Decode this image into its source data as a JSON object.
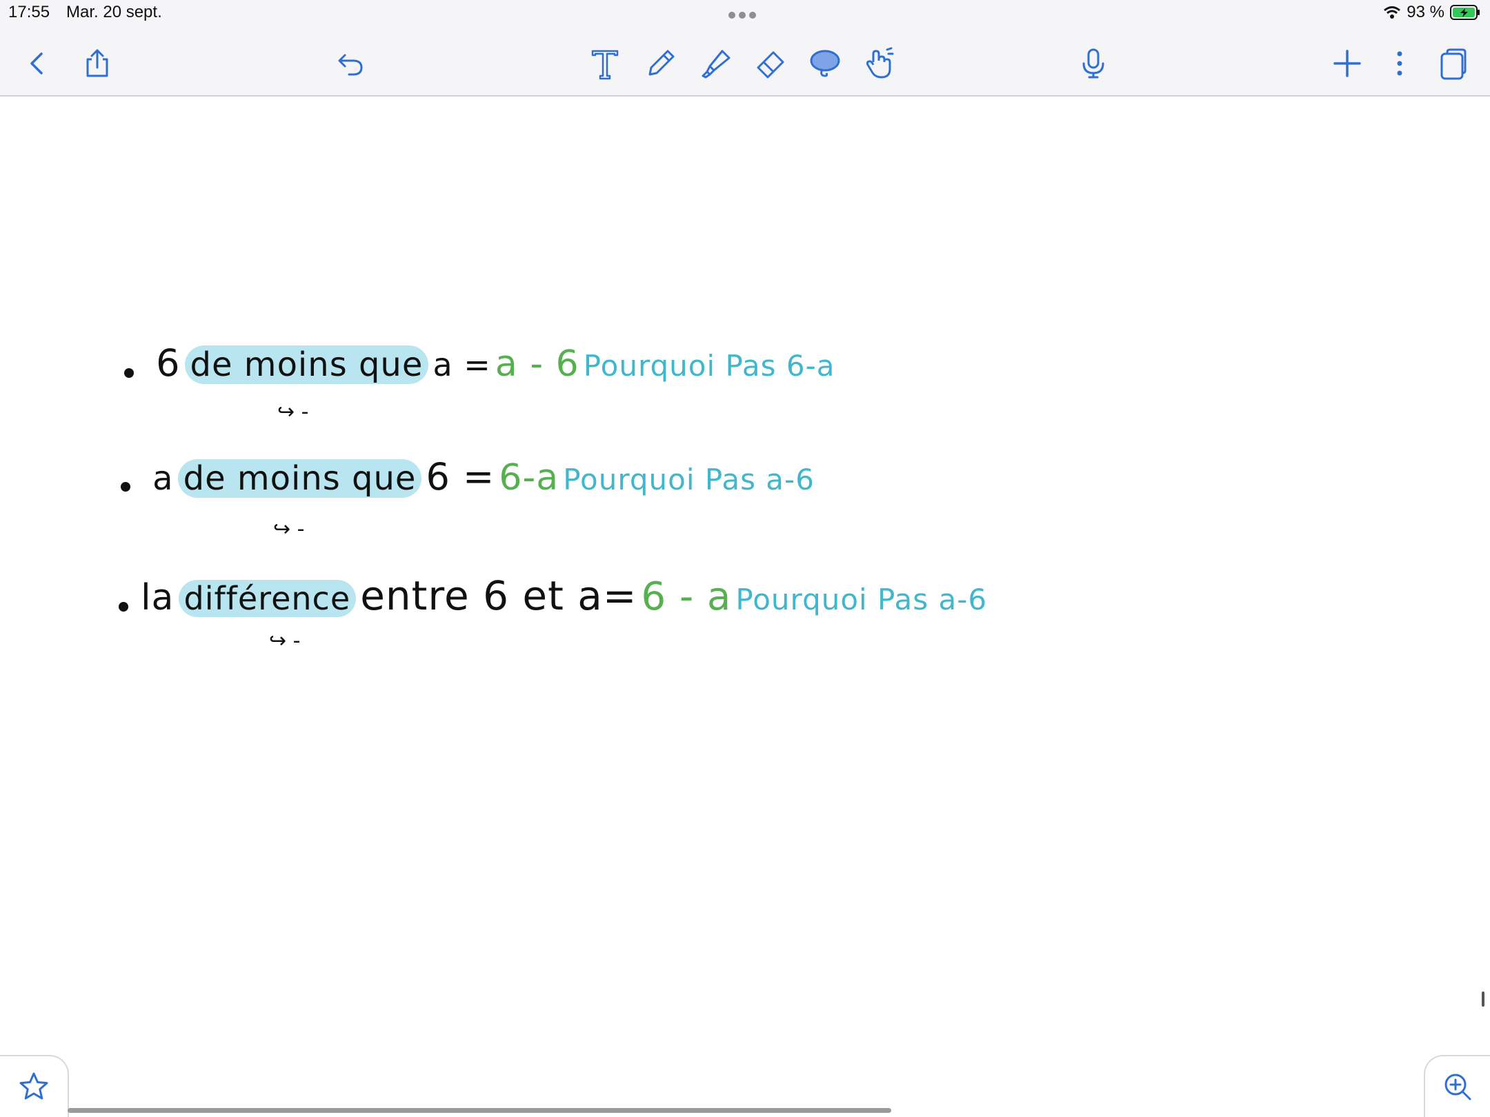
{
  "status_bar": {
    "time": "17:55",
    "date": "Mar. 20 sept.",
    "battery_percent": "93 %",
    "battery_level": 0.93
  },
  "toolbar": {
    "accent_color": "#2f6fd1",
    "icons": [
      "back-chevron-icon",
      "share-icon",
      "undo-icon",
      "text-tool-icon",
      "pen-icon",
      "highlighter-icon",
      "eraser-icon",
      "lasso-icon",
      "hand-touch-icon",
      "microphone-icon",
      "add-icon",
      "more-icon",
      "pages-icon"
    ]
  },
  "note": {
    "lines": [
      {
        "lead": "6",
        "highlight": "de moins que",
        "rest": "a =",
        "answer": "a - 6",
        "question": "Pourquoi Pas 6-a",
        "mark": "↪ -"
      },
      {
        "lead": "a",
        "highlight": "de  moins que",
        "rest": "6 =",
        "answer": "6-a",
        "question": "Pourquoi Pas  a-6",
        "mark": "↪ -"
      },
      {
        "lead": "la",
        "highlight": "différence",
        "rest": "entre 6 et a=",
        "answer": "6 - a",
        "question": "Pourquoi Pas a-6",
        "mark": "↪ -"
      }
    ],
    "colors": {
      "ink": "#111111",
      "highlight": "#b8e5ef",
      "answer": "#56b04f",
      "question": "#41b7cc"
    }
  }
}
